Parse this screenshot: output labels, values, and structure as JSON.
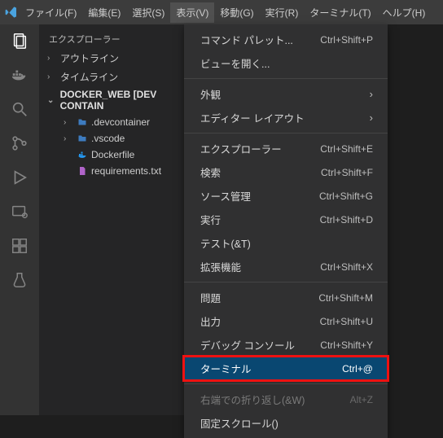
{
  "menubar": {
    "items": [
      {
        "label": "ファイル(F)"
      },
      {
        "label": "編集(E)"
      },
      {
        "label": "選択(S)"
      },
      {
        "label": "表示(V)",
        "active": true
      },
      {
        "label": "移動(G)"
      },
      {
        "label": "実行(R)"
      },
      {
        "label": "ターミナル(T)"
      },
      {
        "label": "ヘルプ(H)"
      }
    ]
  },
  "sidebar": {
    "title": "エクスプローラー",
    "sections": {
      "outline": "アウトライン",
      "timeline": "タイムライン",
      "folder": "DOCKER_WEB [DEV CONTAIN",
      "children": [
        {
          "icon": "folder",
          "label": ".devcontainer"
        },
        {
          "icon": "folder",
          "label": ".vscode"
        },
        {
          "icon": "docker",
          "label": "Dockerfile"
        },
        {
          "icon": "file",
          "label": "requirements.txt"
        }
      ]
    }
  },
  "dropdown": {
    "groups": [
      [
        {
          "label": "コマンド パレット...",
          "kbd": "Ctrl+Shift+P"
        },
        {
          "label": "ビューを開く..."
        }
      ],
      [
        {
          "label": "外観",
          "submenu": true
        },
        {
          "label": "エディター レイアウト",
          "submenu": true
        }
      ],
      [
        {
          "label": "エクスプローラー",
          "kbd": "Ctrl+Shift+E"
        },
        {
          "label": "検索",
          "kbd": "Ctrl+Shift+F"
        },
        {
          "label": "ソース管理",
          "kbd": "Ctrl+Shift+G"
        },
        {
          "label": "実行",
          "kbd": "Ctrl+Shift+D"
        },
        {
          "label": "テスト(&T)"
        },
        {
          "label": "拡張機能",
          "kbd": "Ctrl+Shift+X"
        }
      ],
      [
        {
          "label": "問題",
          "kbd": "Ctrl+Shift+M"
        },
        {
          "label": "出力",
          "kbd": "Ctrl+Shift+U"
        },
        {
          "label": "デバッグ コンソール",
          "kbd": "Ctrl+Shift+Y"
        },
        {
          "label": "ターミナル",
          "kbd": "Ctrl+@",
          "highlight": true
        }
      ],
      [
        {
          "label": "右端での折り返し(&W)",
          "kbd": "Alt+Z",
          "disabled": true
        },
        {
          "label": "固定スクロール()"
        }
      ]
    ]
  }
}
